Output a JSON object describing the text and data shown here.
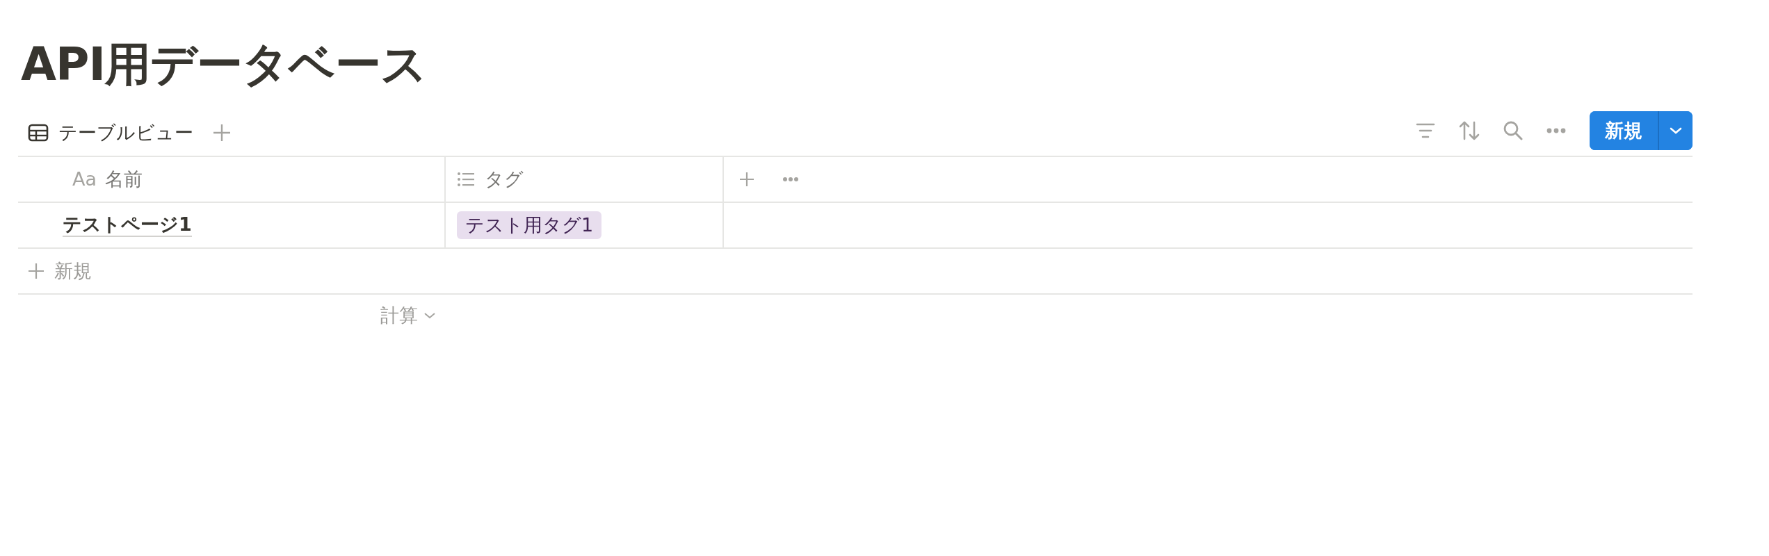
{
  "title": "API用データベース",
  "view_tab": {
    "label": "テーブルビュー"
  },
  "new_button": {
    "label": "新規"
  },
  "table": {
    "columns": [
      {
        "label": "名前",
        "kind": "title",
        "type_label": "Aa"
      },
      {
        "label": "タグ",
        "kind": "multi_select"
      }
    ],
    "rows": [
      {
        "name": "テストページ1",
        "tags": [
          {
            "label": "テスト用タグ1",
            "color": "#e8deee"
          }
        ]
      }
    ],
    "add_row": "新規",
    "footer": {
      "label": "計算"
    }
  }
}
